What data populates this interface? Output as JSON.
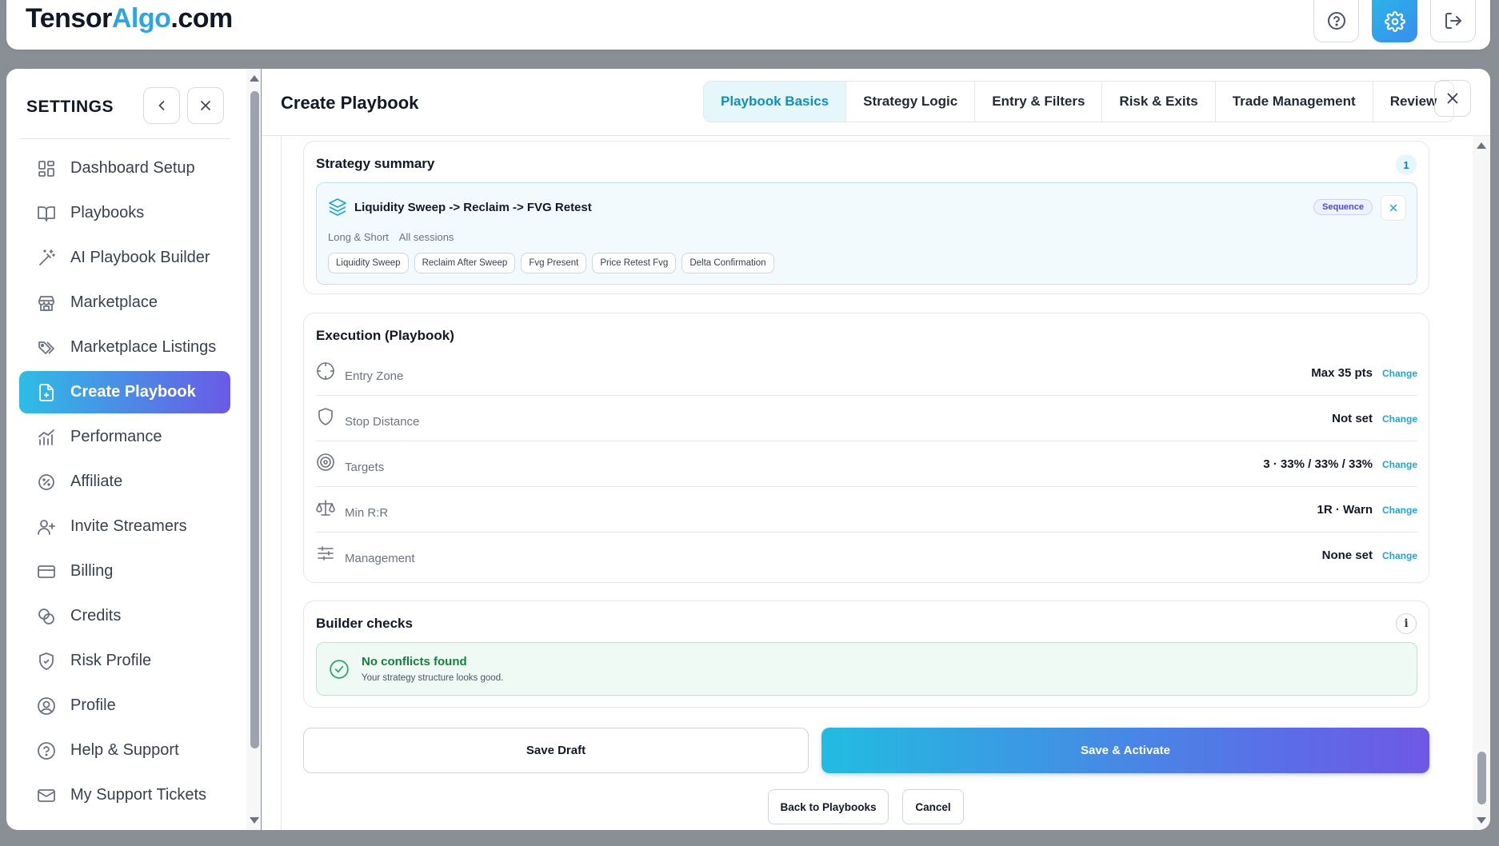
{
  "app": {
    "logo_part1": "Tensor",
    "logo_part2": "Algo",
    "logo_part3": ".com"
  },
  "topbar": {
    "buttons": [
      "help-icon",
      "gear-icon",
      "logout-icon"
    ]
  },
  "sidebar": {
    "title": "SETTINGS",
    "items": [
      {
        "label": "Dashboard Setup",
        "icon": "dashboard-icon"
      },
      {
        "label": "Playbooks",
        "icon": "book-icon"
      },
      {
        "label": "AI Playbook Builder",
        "icon": "wand-icon"
      },
      {
        "label": "Marketplace",
        "icon": "store-icon"
      },
      {
        "label": "Marketplace Listings",
        "icon": "tags-icon"
      },
      {
        "label": "Create Playbook",
        "icon": "file-plus-icon",
        "active": true
      },
      {
        "label": "Performance",
        "icon": "chart-icon"
      },
      {
        "label": "Affiliate",
        "icon": "badge-percent-icon"
      },
      {
        "label": "Invite Streamers",
        "icon": "user-plus-icon"
      },
      {
        "label": "Billing",
        "icon": "credit-card-icon"
      },
      {
        "label": "Credits",
        "icon": "coins-icon"
      },
      {
        "label": "Risk Profile",
        "icon": "shield-check-icon"
      },
      {
        "label": "Profile",
        "icon": "user-circle-icon"
      },
      {
        "label": "Help & Support",
        "icon": "help-circle-icon"
      },
      {
        "label": "My Support Tickets",
        "icon": "ticket-icon"
      }
    ]
  },
  "main": {
    "title": "Create Playbook",
    "tabs": [
      {
        "label": "Playbook Basics",
        "active": true
      },
      {
        "label": "Strategy Logic"
      },
      {
        "label": "Entry & Filters"
      },
      {
        "label": "Risk & Exits"
      },
      {
        "label": "Trade Management"
      },
      {
        "label": "Review"
      }
    ]
  },
  "summary": {
    "title": "Strategy summary",
    "count": "1",
    "strategy": {
      "name": "Liquidity Sweep -> Reclaim -> FVG Retest",
      "badge": "Sequence",
      "direction": "Long & Short",
      "sessions": "All sessions",
      "chips": [
        "Liquidity Sweep",
        "Reclaim After Sweep",
        "Fvg Present",
        "Price Retest Fvg",
        "Delta Confirmation"
      ]
    }
  },
  "execution": {
    "title": "Execution (Playbook)",
    "change_label": "Change",
    "rows": [
      {
        "label": "Entry Zone",
        "value": "Max 35 pts",
        "icon": "crosshair-icon"
      },
      {
        "label": "Stop Distance",
        "value": "Not set",
        "icon": "shield-icon"
      },
      {
        "label": "Targets",
        "value": "3 · 33% / 33% / 33%",
        "icon": "target-icon"
      },
      {
        "label": "Min R:R",
        "value": "1R · Warn",
        "icon": "scale-icon"
      },
      {
        "label": "Management",
        "value": "None set",
        "icon": "sliders-icon"
      }
    ]
  },
  "checks": {
    "title": "Builder checks",
    "info": "i",
    "status_title": "No conflicts found",
    "status_sub": "Your strategy structure looks good."
  },
  "actions": {
    "save_draft": "Save Draft",
    "save_activate": "Save & Activate",
    "back": "Back to Playbooks",
    "cancel": "Cancel"
  },
  "colors": {
    "accent": "#1fa5d6",
    "brand_blue": "#2aa7e0",
    "success": "#15803d",
    "gradient_start": "#22bce0",
    "gradient_end": "#6f58e5"
  }
}
